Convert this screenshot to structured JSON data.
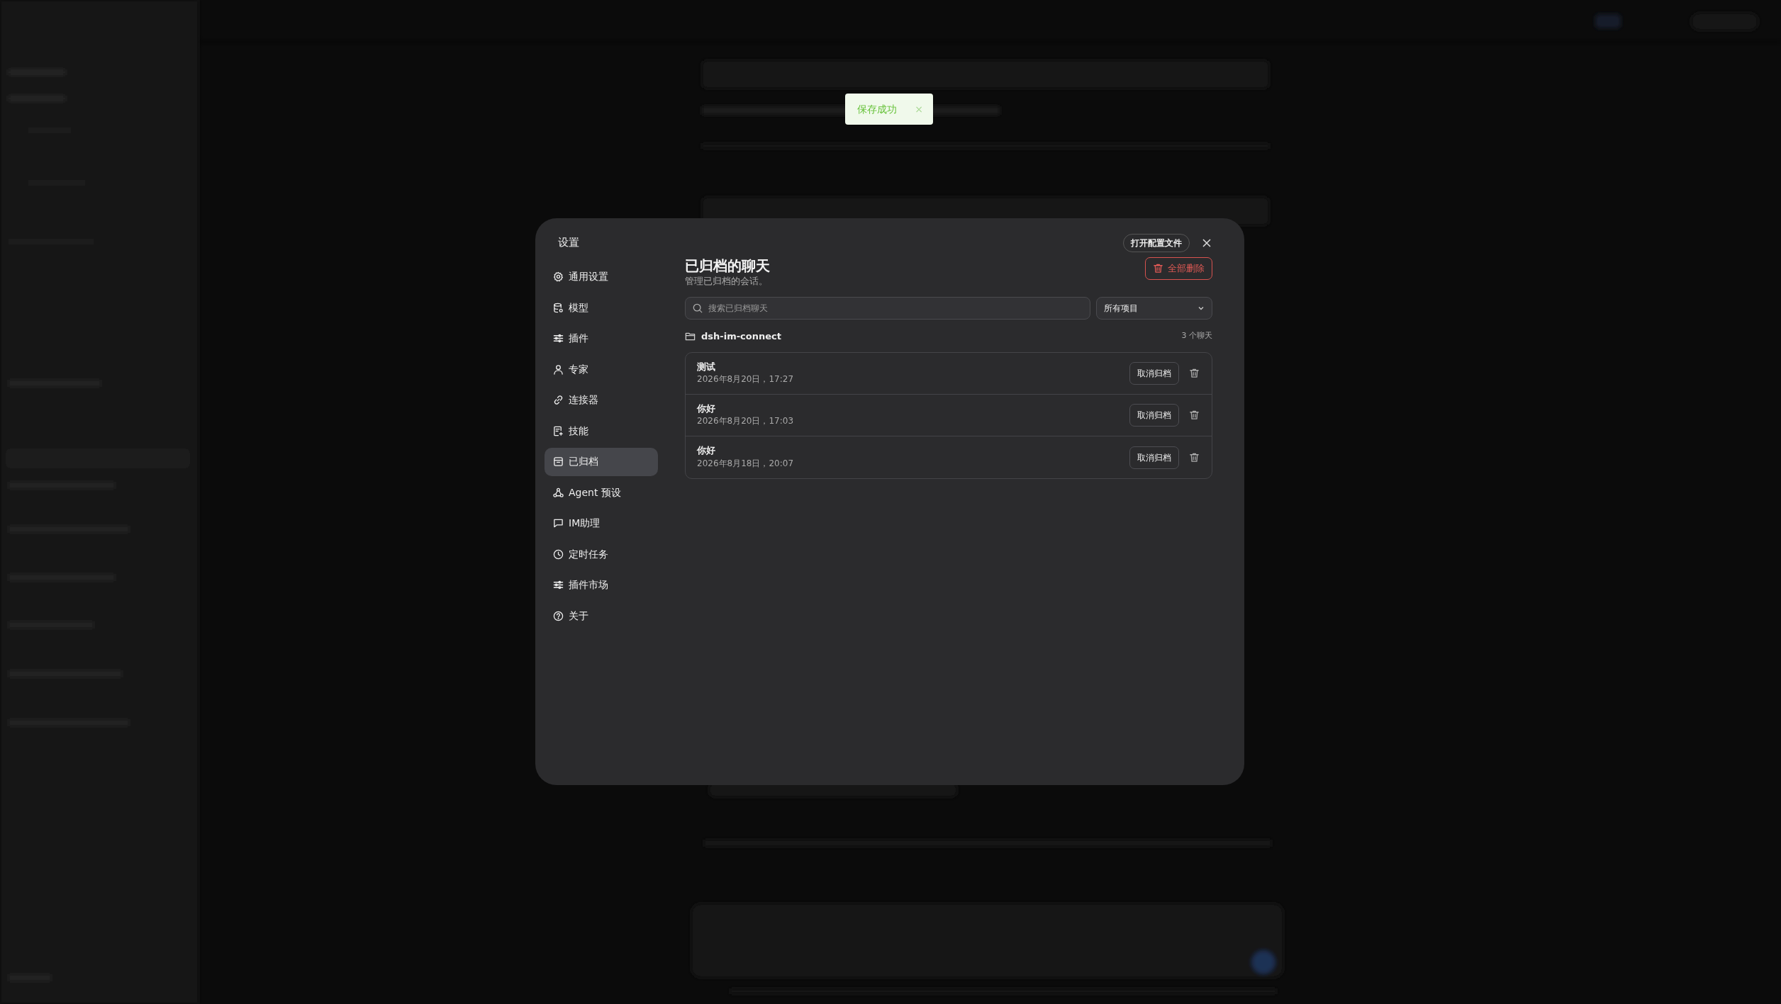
{
  "toast": {
    "text": "保存成功",
    "close": "×"
  },
  "dialog": {
    "title": "设置",
    "open_config_button": "打开配置文件",
    "nav": [
      {
        "label": "通用设置",
        "selected": false
      },
      {
        "label": "模型",
        "selected": false
      },
      {
        "label": "插件",
        "selected": false
      },
      {
        "label": "专家",
        "selected": false
      },
      {
        "label": "连接器",
        "selected": false
      },
      {
        "label": "技能",
        "selected": false
      },
      {
        "label": "已归档",
        "selected": true
      },
      {
        "label": "Agent 预设",
        "selected": false
      },
      {
        "label": "IM助理",
        "selected": false
      },
      {
        "label": "定时任务",
        "selected": false
      },
      {
        "label": "插件市场",
        "selected": false
      },
      {
        "label": "关于",
        "selected": false
      }
    ],
    "page": {
      "title": "已归档的聊天",
      "subtitle": "管理已归档的会话。",
      "delete_all_button": "全部删除",
      "search": {
        "placeholder": "搜索已归档聊天"
      },
      "project_filter": {
        "value": "所有项目"
      },
      "groups": [
        {
          "name": "dsh-im-connect",
          "count": "3 个聊天",
          "chats": [
            {
              "title": "测试",
              "time": "2026年8月20日，17:27",
              "unarchive_button": "取消归档"
            },
            {
              "title": "你好",
              "time": "2026年8月20日，17:03",
              "unarchive_button": "取消归档"
            },
            {
              "title": "你好",
              "time": "2026年8月18日，20:07",
              "unarchive_button": "取消归档"
            }
          ]
        }
      ]
    }
  }
}
